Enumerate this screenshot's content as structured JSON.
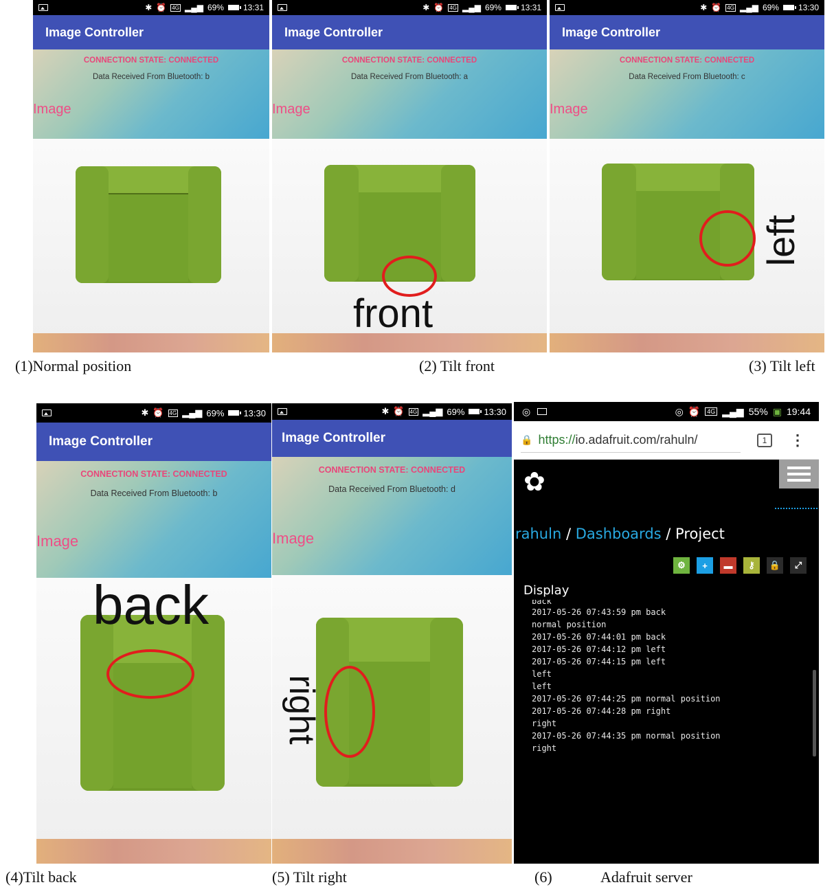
{
  "apps": [
    {
      "status_time": "13:31",
      "battery": "69%",
      "network": "4G",
      "title": "Image Controller",
      "connection": "CONNECTION STATE: CONNECTED",
      "data_text": "Data Received From Bluetooth: b",
      "image_label": "Image",
      "overlay": "",
      "caption": "(1)Normal position"
    },
    {
      "status_time": "13:31",
      "battery": "69%",
      "network": "4G",
      "title": "Image Controller",
      "connection": "CONNECTION STATE: CONNECTED",
      "data_text": "Data Received From Bluetooth: a",
      "image_label": "Image",
      "overlay": "front",
      "caption": "(2) Tilt front"
    },
    {
      "status_time": "13:30",
      "battery": "69%",
      "network": "4G",
      "title": "Image Controller",
      "connection": "CONNECTION STATE: CONNECTED",
      "data_text": "Data Received From Bluetooth: c",
      "image_label": "Image",
      "overlay": "left",
      "caption": "(3) Tilt left"
    },
    {
      "status_time": "13:30",
      "battery": "69%",
      "network": "4G",
      "title": "Image Controller",
      "connection": "CONNECTION STATE: CONNECTED",
      "data_text": "Data Received From Bluetooth: b",
      "image_label": "Image",
      "overlay": "back",
      "caption": "(4)Tilt back"
    },
    {
      "status_time": "13:30",
      "battery": "69%",
      "network": "4G",
      "title": "Image Controller",
      "connection": "CONNECTION STATE: CONNECTED",
      "data_text": "Data Received From Bluetooth: d",
      "image_label": "Image",
      "overlay": "right",
      "caption": "(5) Tilt right"
    }
  ],
  "dashboard": {
    "status_time": "19:44",
    "battery": "55%",
    "network": "4G",
    "url_scheme": "https://",
    "url_rest": "io.adafruit.com/rahuln/",
    "tab_count": "1",
    "breadcrumb": {
      "user": "rahuln",
      "sep1": "/",
      "section": "Dashboards",
      "sep2": "/",
      "page": "Project"
    },
    "block_title": "Display",
    "log": [
      "back",
      "2017-05-26 07:43:59 pm back",
      "normal position",
      "2017-05-26 07:44:01 pm back",
      "2017-05-26 07:44:12 pm left",
      "2017-05-26 07:44:15 pm left",
      "left",
      "left",
      "2017-05-26 07:44:25 pm normal position",
      "2017-05-26 07:44:28 pm right",
      "right",
      "2017-05-26 07:44:35 pm normal position",
      "right"
    ],
    "toolbar_colors": [
      "#6fb43f",
      "#1c9fe4",
      "#c0392b",
      "#a8b43a",
      "#2b2b2b",
      "#2b2b2b"
    ],
    "caption_num": "(6)",
    "caption_text": "Adafruit server"
  }
}
